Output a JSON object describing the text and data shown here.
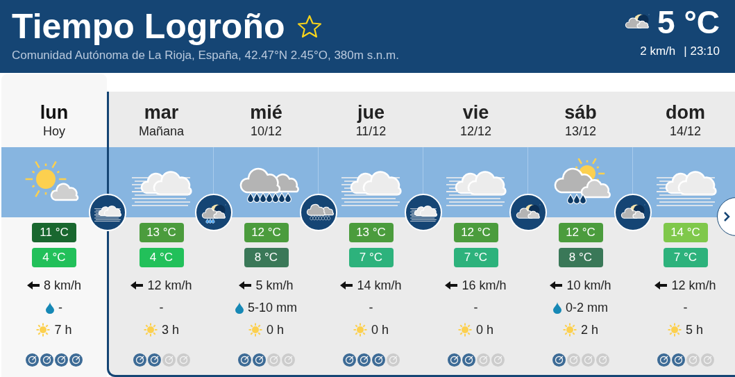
{
  "header": {
    "title": "Tiempo Logroño",
    "favorite": false,
    "subtitle": "Comunidad Autónoma de La Rioja, España, 42.47°N 2.45°O, 380m s.n.m."
  },
  "current": {
    "icon": {
      "kind": "moon-cloud"
    },
    "temp": "5 °C",
    "wind": "2 km/h",
    "time": "| 23:10"
  },
  "days": [
    {
      "name": "lun",
      "date": "Hoy",
      "selected": true,
      "sky": {
        "kind": "sun-cloud"
      },
      "night": {
        "kind": "fog"
      },
      "max": {
        "text": "11 °C",
        "color": "#19672f"
      },
      "min": {
        "text": "4 °C",
        "color": "#22c05a"
      },
      "wind": "8 km/h",
      "drop": true,
      "rain": "-",
      "sun": "7 h",
      "stars": 4
    },
    {
      "name": "mar",
      "date": "Mañana",
      "selected": false,
      "sky": {
        "kind": "fog"
      },
      "night": {
        "kind": "moon-rain"
      },
      "max": {
        "text": "13 °C",
        "color": "#4b9c3d"
      },
      "min": {
        "text": "4 °C",
        "color": "#22c05a"
      },
      "wind": "12 km/h",
      "drop": false,
      "rain": "-",
      "sun": "3 h",
      "stars": 2
    },
    {
      "name": "mié",
      "date": "10/12",
      "selected": false,
      "sky": {
        "kind": "rain"
      },
      "night": {
        "kind": "rain"
      },
      "max": {
        "text": "12 °C",
        "color": "#4b9c3d"
      },
      "min": {
        "text": "8 °C",
        "color": "#3a7858"
      },
      "wind": "5 km/h",
      "drop": true,
      "rain": "5-10 mm",
      "sun": "0 h",
      "stars": 2
    },
    {
      "name": "jue",
      "date": "11/12",
      "selected": false,
      "sky": {
        "kind": "fog"
      },
      "night": {
        "kind": "fog"
      },
      "max": {
        "text": "13 °C",
        "color": "#4b9c3d"
      },
      "min": {
        "text": "7 °C",
        "color": "#2db27c"
      },
      "wind": "14 km/h",
      "drop": false,
      "rain": "-",
      "sun": "0 h",
      "stars": 3
    },
    {
      "name": "vie",
      "date": "12/12",
      "selected": false,
      "sky": {
        "kind": "fog"
      },
      "night": {
        "kind": "moon-cloud"
      },
      "max": {
        "text": "12 °C",
        "color": "#4b9c3d"
      },
      "min": {
        "text": "7 °C",
        "color": "#2db27c"
      },
      "wind": "16 km/h",
      "drop": false,
      "rain": "-",
      "sun": "0 h",
      "stars": 2
    },
    {
      "name": "sáb",
      "date": "13/12",
      "selected": false,
      "sky": {
        "kind": "sun-rain"
      },
      "night": {
        "kind": "moon-cloud"
      },
      "max": {
        "text": "12 °C",
        "color": "#4b9c3d"
      },
      "min": {
        "text": "8 °C",
        "color": "#3a7858"
      },
      "wind": "10 km/h",
      "drop": true,
      "rain": "0-2 mm",
      "sun": "2 h",
      "stars": 1
    },
    {
      "name": "dom",
      "date": "14/12",
      "selected": false,
      "sky": {
        "kind": "fog"
      },
      "max": {
        "text": "14 °C",
        "color": "#7fc84b"
      },
      "min": {
        "text": "7 °C",
        "color": "#2db27c"
      },
      "wind": "12 km/h",
      "drop": false,
      "rain": "-",
      "sun": "5 h",
      "stars": 2
    }
  ]
}
